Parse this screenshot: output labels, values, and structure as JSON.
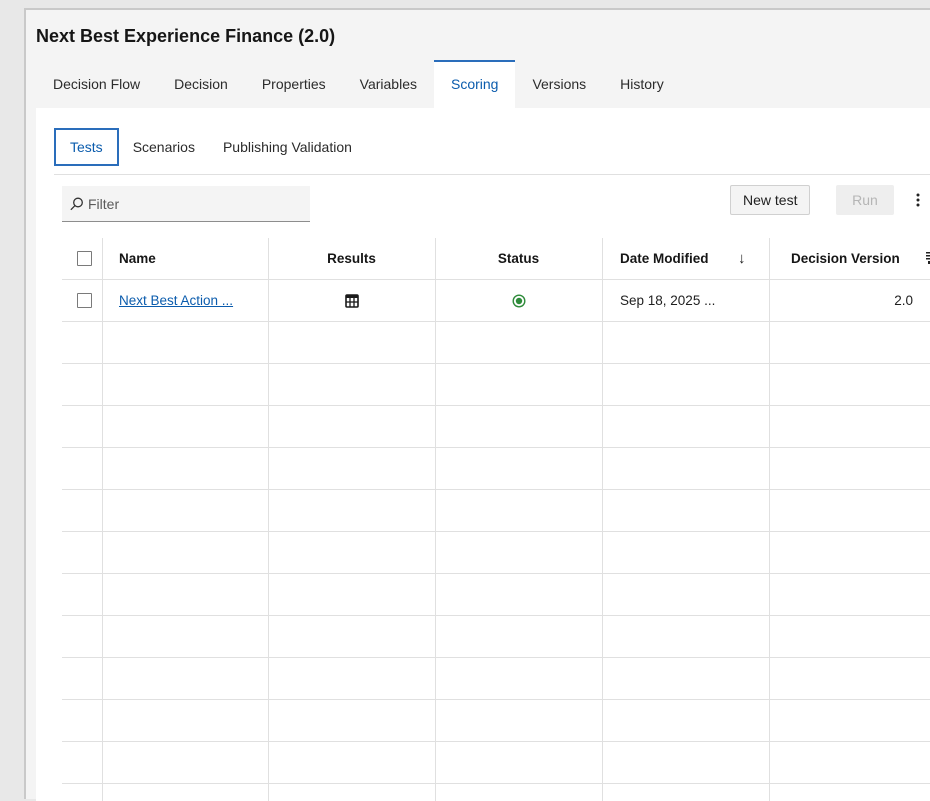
{
  "title": "Next Best Experience Finance (2.0)",
  "main_tabs": [
    {
      "label": "Decision Flow",
      "active": false
    },
    {
      "label": "Decision",
      "active": false
    },
    {
      "label": "Properties",
      "active": false
    },
    {
      "label": "Variables",
      "active": false
    },
    {
      "label": "Scoring",
      "active": true
    },
    {
      "label": "Versions",
      "active": false
    },
    {
      "label": "History",
      "active": false
    }
  ],
  "sub_tabs": [
    {
      "label": "Tests",
      "active": true
    },
    {
      "label": "Scenarios",
      "active": false
    },
    {
      "label": "Publishing Validation",
      "active": false
    }
  ],
  "toolbar": {
    "filter_placeholder": "Filter",
    "new_test_label": "New test",
    "run_label": "Run",
    "run_disabled": true
  },
  "table": {
    "headers": {
      "name": "Name",
      "results": "Results",
      "status": "Status",
      "date_modified": "Date Modified",
      "sort_indicator": "↓",
      "decision_version": "Decision Version"
    },
    "rows": [
      {
        "name": "Next Best Action ...",
        "results_icon": "results-table-icon",
        "status_icon": "status-complete-icon",
        "date_modified": "Sep 18, 2025 ...",
        "decision_version": "2.0"
      }
    ]
  },
  "colors": {
    "accent": "#2a6dbb",
    "link": "#0b5cad",
    "status_green": "#2e8b3a"
  }
}
